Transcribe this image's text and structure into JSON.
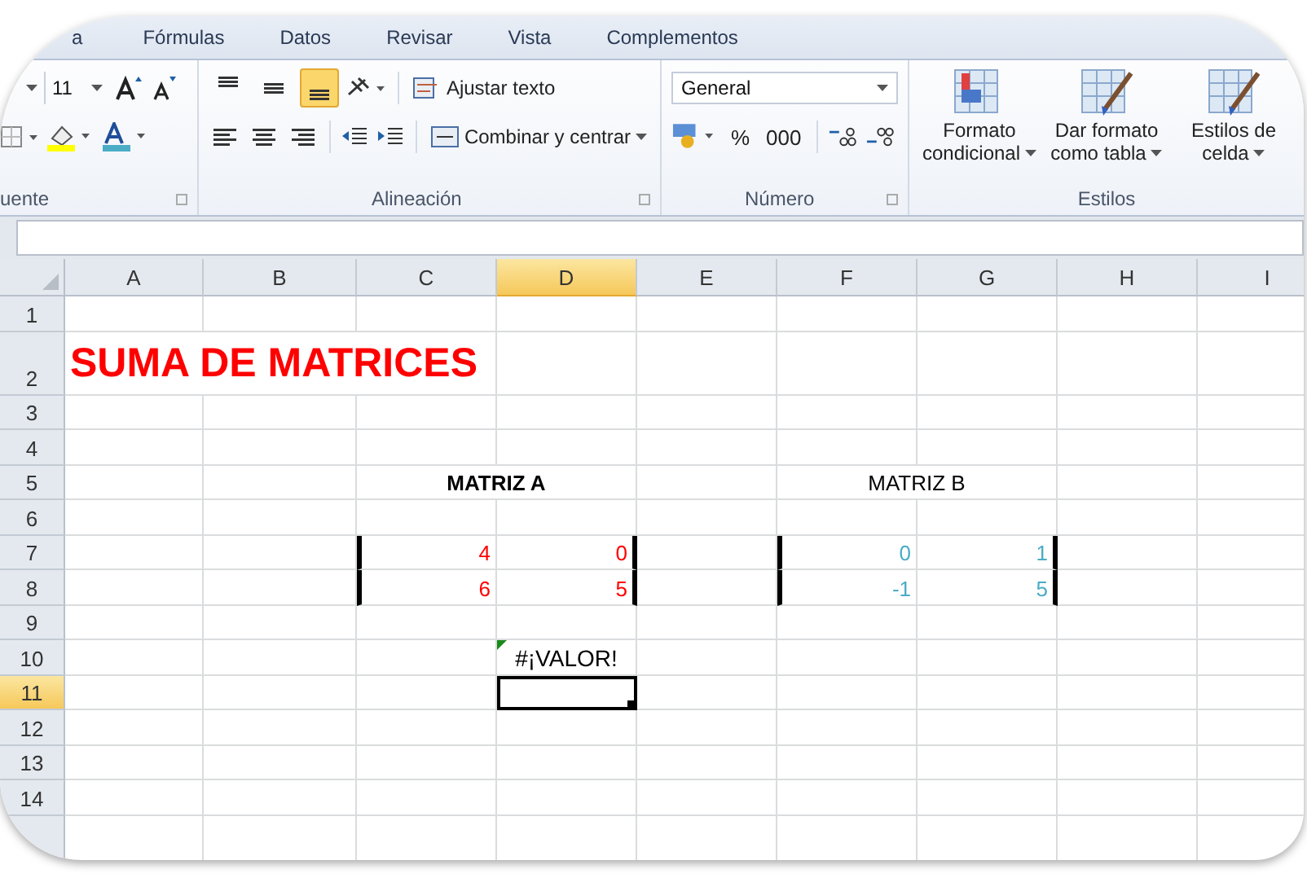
{
  "tabs": [
    {
      "label": "a",
      "selected": false
    },
    {
      "label": "Fórmulas",
      "selected": false
    },
    {
      "label": "Datos",
      "selected": false
    },
    {
      "label": "Revisar",
      "selected": false
    },
    {
      "label": "Vista",
      "selected": false
    },
    {
      "label": "Complementos",
      "selected": false
    }
  ],
  "ribbon": {
    "font": {
      "label": "uente",
      "size": "11"
    },
    "alignment": {
      "label": "Alineación",
      "vertical": [
        {
          "selected": false
        },
        {
          "selected": false
        },
        {
          "selected": true
        }
      ],
      "wrap_text": "Ajustar texto",
      "merge_center": "Combinar y centrar"
    },
    "number": {
      "label": "Número",
      "format": "General",
      "percent": "%",
      "thousands": "000"
    },
    "styles": {
      "label": "Estilos",
      "buttons": [
        {
          "lines": [
            "Formato",
            "condicional"
          ]
        },
        {
          "lines": [
            "Dar formato",
            "como tabla"
          ]
        },
        {
          "lines": [
            "Estilos de",
            "celda"
          ]
        }
      ]
    }
  },
  "sheet": {
    "columns": [
      {
        "label": "A",
        "selected": false
      },
      {
        "label": "B",
        "selected": false
      },
      {
        "label": "C",
        "selected": false
      },
      {
        "label": "D",
        "selected": true
      },
      {
        "label": "E",
        "selected": false
      },
      {
        "label": "F",
        "selected": false
      },
      {
        "label": "G",
        "selected": false
      },
      {
        "label": "H",
        "selected": false
      },
      {
        "label": "I",
        "selected": false
      }
    ],
    "rows": [
      {
        "label": "1",
        "selected": false
      },
      {
        "label": "2",
        "selected": false,
        "cells": [
          {
            "text": "SUMA DE MATRICES",
            "kind": "title",
            "color": "#ff0000"
          },
          null,
          null,
          null,
          null,
          null,
          null,
          null,
          null
        ]
      },
      {
        "label": "3",
        "selected": false
      },
      {
        "label": "4",
        "selected": false
      },
      {
        "label": "5",
        "selected": false,
        "cells": [
          null,
          null,
          {
            "text": "MATRIZ A",
            "kind": "header",
            "bold": true
          },
          null,
          null,
          {
            "text": "MATRIZ B",
            "kind": "header",
            "bold": false
          },
          null,
          null,
          null
        ]
      },
      {
        "label": "6",
        "selected": false
      },
      {
        "label": "7",
        "selected": false,
        "cells": [
          null,
          null,
          {
            "text": "4",
            "kind": "number",
            "color": "#ff0000",
            "left_bar": true
          },
          {
            "text": "0",
            "kind": "number",
            "color": "#ff0000",
            "right_bar": true
          },
          null,
          {
            "text": "0",
            "kind": "number",
            "color": "#4bacc6",
            "left_bar": true
          },
          {
            "text": "1",
            "kind": "number",
            "color": "#4bacc6",
            "right_bar": true
          },
          null,
          null
        ]
      },
      {
        "label": "8",
        "selected": false,
        "cells": [
          null,
          null,
          {
            "text": "6",
            "kind": "number",
            "color": "#ff0000",
            "left_bar": true
          },
          {
            "text": "5",
            "kind": "number",
            "color": "#ff0000",
            "right_bar": true
          },
          null,
          {
            "text": "-1",
            "kind": "number",
            "color": "#4bacc6",
            "left_bar": true
          },
          {
            "text": "5",
            "kind": "number",
            "color": "#4bacc6",
            "right_bar": true
          },
          null,
          null
        ]
      },
      {
        "label": "9",
        "selected": false
      },
      {
        "label": "10",
        "selected": false,
        "cells": [
          null,
          null,
          null,
          {
            "text": "#¡VALOR!",
            "kind": "error"
          },
          null,
          null,
          null,
          null,
          null
        ]
      },
      {
        "label": "11",
        "selected": true,
        "cells": [
          null,
          null,
          null,
          {
            "kind": "empty",
            "selected": true
          },
          null,
          null,
          null,
          null,
          null
        ]
      },
      {
        "label": "12",
        "selected": false
      },
      {
        "label": "13",
        "selected": false
      },
      {
        "label": "14",
        "selected": false
      }
    ]
  }
}
